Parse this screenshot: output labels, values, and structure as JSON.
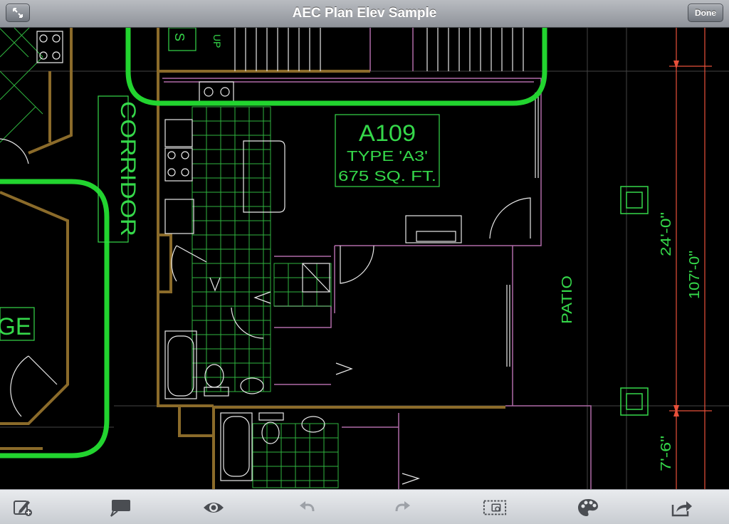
{
  "header": {
    "title": "AEC Plan Elev Sample",
    "done_label": "Done"
  },
  "drawing": {
    "unit_label_1": "A109",
    "unit_label_2": "TYPE 'A3'",
    "unit_label_3": "675 SQ. FT.",
    "corridor_label": "CORRIDOR",
    "patio_label": "PATIO",
    "partial_label": "GE",
    "dim_1": "24'-0\"",
    "dim_2": "107'-0\"",
    "dim_3": "7'-6\"",
    "stair_label_up": "UP",
    "stair_label_s": "S"
  },
  "toolbar": {
    "icons": [
      "markup-pen-icon",
      "comment-icon",
      "eye-icon",
      "undo-icon",
      "redo-icon",
      "select-region-icon",
      "palette-icon",
      "share-icon"
    ]
  },
  "colors": {
    "cad_green": "#35d84a",
    "wall_gold": "#8b6b2a",
    "line_white": "#e9e9e9",
    "line_magenta": "#b06aa8",
    "dim_red": "#e8503a"
  }
}
